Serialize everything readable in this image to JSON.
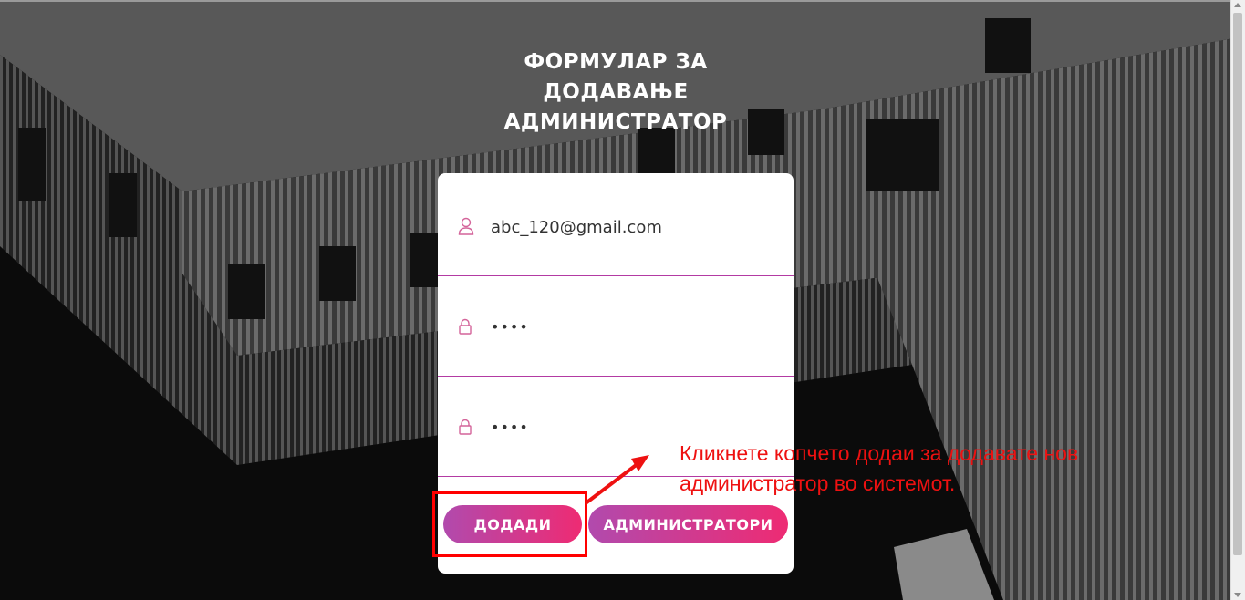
{
  "page": {
    "title": "ФОРМУЛАР ЗА ДОДАВАЊЕ АДМИНИСТРАТОР"
  },
  "form": {
    "email": {
      "value": "abc_120@gmail.com",
      "icon": "user-icon"
    },
    "password": {
      "value": "••••",
      "icon": "lock-icon"
    },
    "confirm_password": {
      "value": "••••",
      "icon": "lock-icon"
    },
    "add_button": "ДОДАДИ",
    "admins_button": "АДМИНИСТРАТОРИ"
  },
  "annotation": {
    "text": "Кликнете копчето додаи за додавате нов администратор во системот.",
    "color": "#ee1111"
  },
  "colors": {
    "accent_start": "#b14aad",
    "accent_end": "#ee2b73",
    "field_border": "#b33aa3"
  }
}
